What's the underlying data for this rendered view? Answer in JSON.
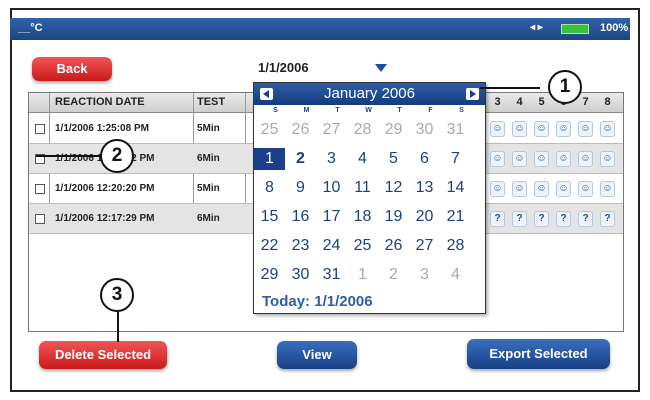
{
  "status": {
    "temp": "__°C",
    "signal": "◂ ▸",
    "battery": "100%"
  },
  "buttons": {
    "back": "Back",
    "delete": "Delete Selected",
    "view": "View",
    "export": "Export Selected"
  },
  "date_selector": {
    "value": "1/1/2006"
  },
  "table": {
    "headers": [
      "REACTION DATE",
      "TEST"
    ],
    "result_columns": [
      "3",
      "4",
      "5",
      "6",
      "7",
      "8"
    ],
    "rows": [
      {
        "date": "1/1/2006 1:25:08 PM",
        "test": "5Min",
        "results": [
          "☺",
          "☺",
          "☺",
          "☺",
          "☺",
          "☺"
        ]
      },
      {
        "date": "1/1/2006 12:50:52 PM",
        "test": "6Min",
        "results": [
          "☺",
          "☺",
          "☺",
          "☺",
          "☺",
          "☺"
        ]
      },
      {
        "date": "1/1/2006 12:20:20 PM",
        "test": "5Min",
        "results": [
          "☺",
          "☺",
          "☺",
          "☺",
          "☺",
          "☺"
        ]
      },
      {
        "date": "1/1/2006 12:17:29 PM",
        "test": "6Min",
        "results": [
          "?",
          "?",
          "?",
          "?",
          "?",
          "?"
        ]
      }
    ]
  },
  "calendar": {
    "title": "January 2006",
    "weekdays": [
      "S",
      "M",
      "T",
      "W",
      "T",
      "F",
      "S"
    ],
    "weeks": [
      [
        "25",
        "26",
        "27",
        "28",
        "29",
        "30",
        "31"
      ],
      [
        "1",
        "2",
        "3",
        "4",
        "5",
        "6",
        "7"
      ],
      [
        "8",
        "9",
        "10",
        "11",
        "12",
        "13",
        "14"
      ],
      [
        "15",
        "16",
        "17",
        "18",
        "19",
        "20",
        "21"
      ],
      [
        "22",
        "23",
        "24",
        "25",
        "26",
        "27",
        "28"
      ],
      [
        "29",
        "30",
        "31",
        "1",
        "2",
        "3",
        "4"
      ]
    ],
    "selected": "1",
    "today_label": "Today: 1/1/2006"
  },
  "callouts": [
    "1",
    "2",
    "3"
  ],
  "colors": {
    "brand_blue": "#1d4586",
    "button_red": "#d42020",
    "selected_day": "#1c3f8a"
  }
}
